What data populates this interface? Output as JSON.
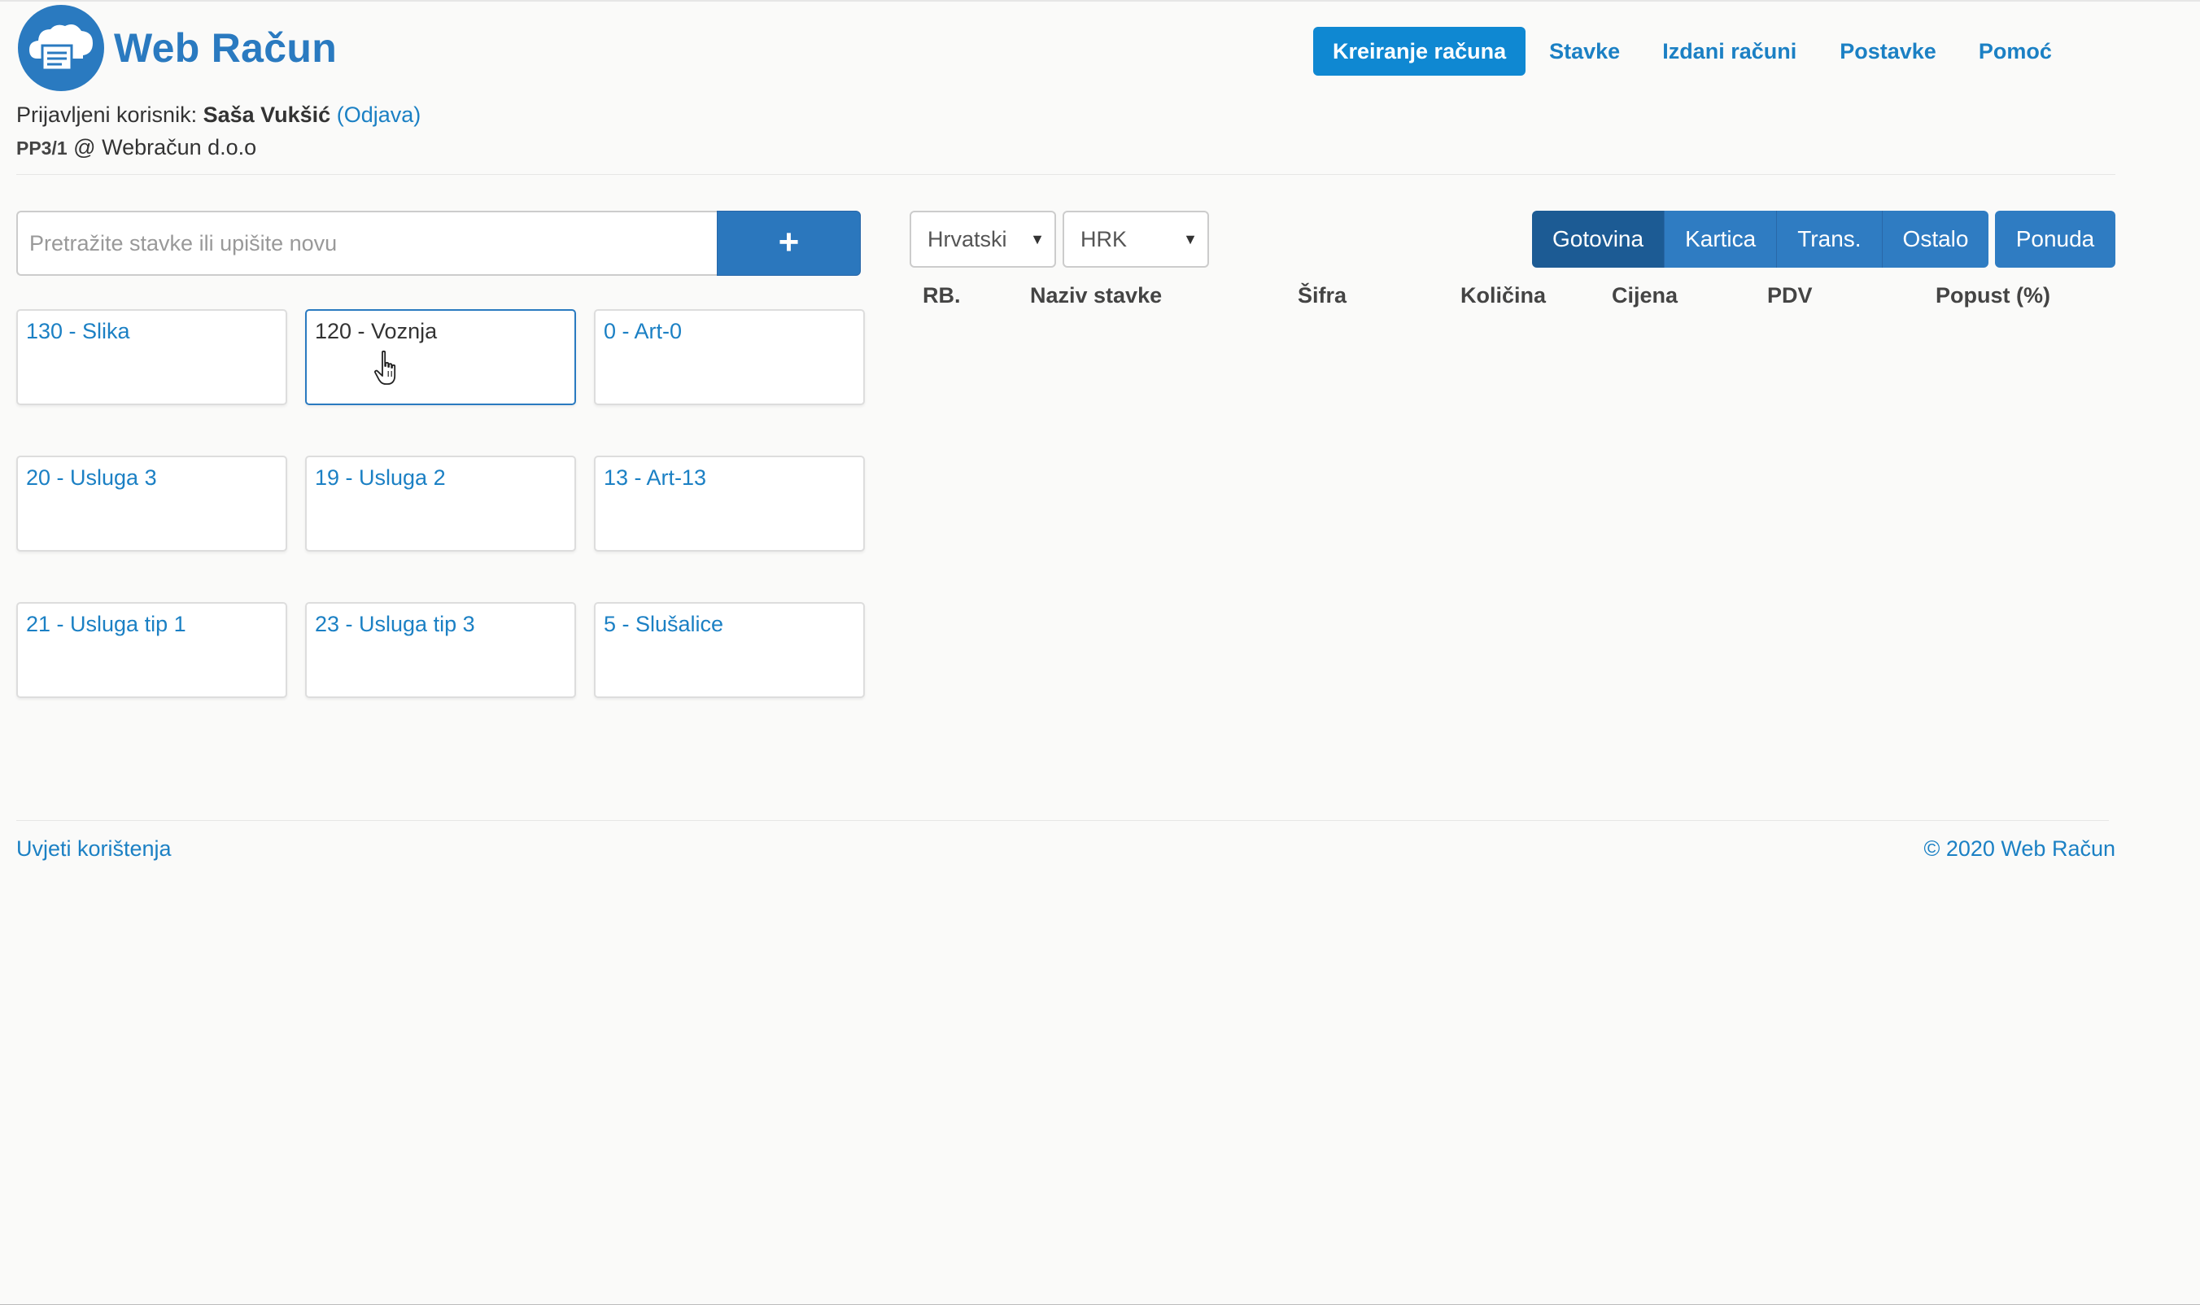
{
  "app": {
    "title": "Web Račun",
    "icon": "cloud-receipt-icon",
    "brand_color": "#2a7ac0"
  },
  "nav": {
    "items": [
      "Kreiranje računa",
      "Stavke",
      "Izdani računi",
      "Postavke",
      "Pomoć"
    ],
    "active": "Kreiranje računa",
    "active_color": "#0f88d2"
  },
  "user": {
    "prefix": "Prijavljeni korisnik:",
    "name": "Saša Vukšić",
    "logout": "(Odjava)",
    "point": "PP3/1",
    "company": "@ Webračun d.o.o"
  },
  "search": {
    "placeholder": "Pretražite stavke ili upišite novu",
    "value": "",
    "add_label": "+"
  },
  "items": [
    "130 - Slika",
    "120 - Voznja",
    "0 - Art-0",
    "20 - Usluga 3",
    "19 - Usluga 2",
    "13 - Art-13",
    "21 - Usluga tip 1",
    "23 - Usluga tip 3",
    "5 - Slušalice"
  ],
  "hovered_item": "120 - Voznja",
  "language": {
    "selected": "Hrvatski"
  },
  "currency": {
    "selected": "HRK"
  },
  "payment": {
    "options": [
      "Gotovina",
      "Kartica",
      "Trans.",
      "Ostalo"
    ],
    "selected": "Gotovina",
    "offer_label": "Ponuda"
  },
  "table": {
    "columns": [
      "RB.",
      "Naziv stavke",
      "Šifra",
      "Količina",
      "Cijena",
      "PDV",
      "Popust (%)"
    ],
    "rows": []
  },
  "footer": {
    "terms": "Uvjeti korištenja",
    "copyright": "© 2020 Web Račun"
  }
}
